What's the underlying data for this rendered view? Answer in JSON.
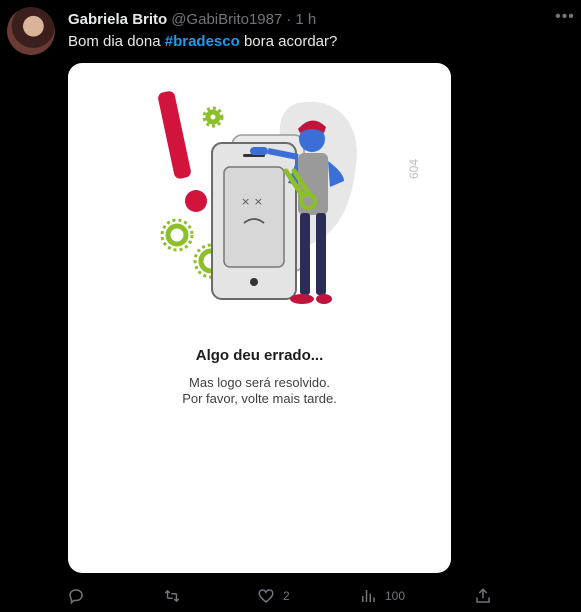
{
  "tweet": {
    "author_name": "Gabriela Brito",
    "handle": "@GabiBrito1987",
    "separator": "·",
    "time": "1 h",
    "more_icon": "more-horizontal-icon",
    "text_before": "Bom dia dona ",
    "hashtag": "#bradesco",
    "text_after": " bora acordar?"
  },
  "media": {
    "error_code": "604",
    "error_title": "Algo deu errado...",
    "error_line1": "Mas logo será resolvido.",
    "error_line2": "Por favor, volte mais tarde.",
    "illustration": "broken-phone-mechanic-illustration"
  },
  "actions": {
    "reply": {
      "icon": "reply-icon",
      "count": ""
    },
    "retweet": {
      "icon": "retweet-icon",
      "count": ""
    },
    "like": {
      "icon": "heart-icon",
      "count": "2"
    },
    "views": {
      "icon": "analytics-icon",
      "count": "100"
    },
    "share": {
      "icon": "share-icon",
      "count": ""
    }
  },
  "colors": {
    "background": "#000000",
    "text": "#e7e9ea",
    "muted": "#71767b",
    "link": "#1d9bf0",
    "alert_red": "#d2143c",
    "gear_green": "#8cbf2a"
  }
}
